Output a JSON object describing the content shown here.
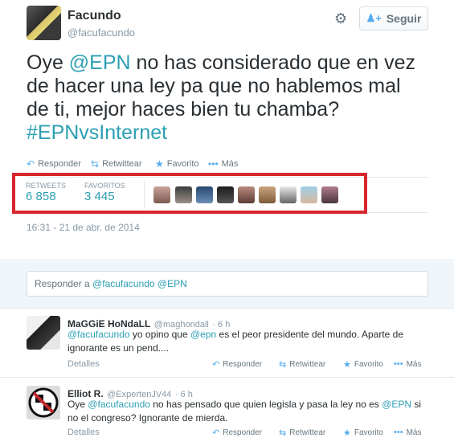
{
  "header": {
    "name": "Facundo",
    "handle": "@facufacundo",
    "follow_label": "Seguir"
  },
  "tweet": {
    "text_1": "Oye ",
    "mention": "@EPN",
    "text_2": " no has considerado que en vez de hacer una ley pa que no hablemos mal de ti, mejor haces bien tu chamba? ",
    "hashtag": "#EPNvsInternet"
  },
  "actions": {
    "reply": "Responder",
    "retweet": "Retwittear",
    "favorite": "Favorito",
    "more": "Más"
  },
  "stats": {
    "retweets_label": "RETWEETS",
    "retweets_value": "6 858",
    "favorites_label": "FAVORITOS",
    "favorites_value": "3 445"
  },
  "timestamp": "16:31 - 21 de abr. de 2014",
  "reply_box": {
    "prefix": "Responder a ",
    "mentions": "@facufacundo @EPN"
  },
  "replies": [
    {
      "name": "MaGGiE HoNdaLL",
      "handle": "@maghondall",
      "time": "· 6 h",
      "mention_1": "@facufacundo",
      "text_1": " yo opino que ",
      "mention_2": "@epn",
      "text_2": " es el peor presidente del mundo. Aparte de ignorante es un pend....",
      "details": "Detalles"
    },
    {
      "name": "Elliot R.",
      "handle": "@ExpertenJV44",
      "time": "· 6 h",
      "text_1": "Oye ",
      "mention_1": "@facufacundo",
      "text_2": " no has pensado que quien legisla y pasa la ley no es ",
      "mention_2": "@EPN",
      "text_3": " si no el congreso? Ignorante de mierda.",
      "details": "Detalles"
    }
  ],
  "colors": {
    "accent": "#2b9fb3",
    "highlight_border": "#d7262d",
    "icon_blue": "#55acee"
  }
}
